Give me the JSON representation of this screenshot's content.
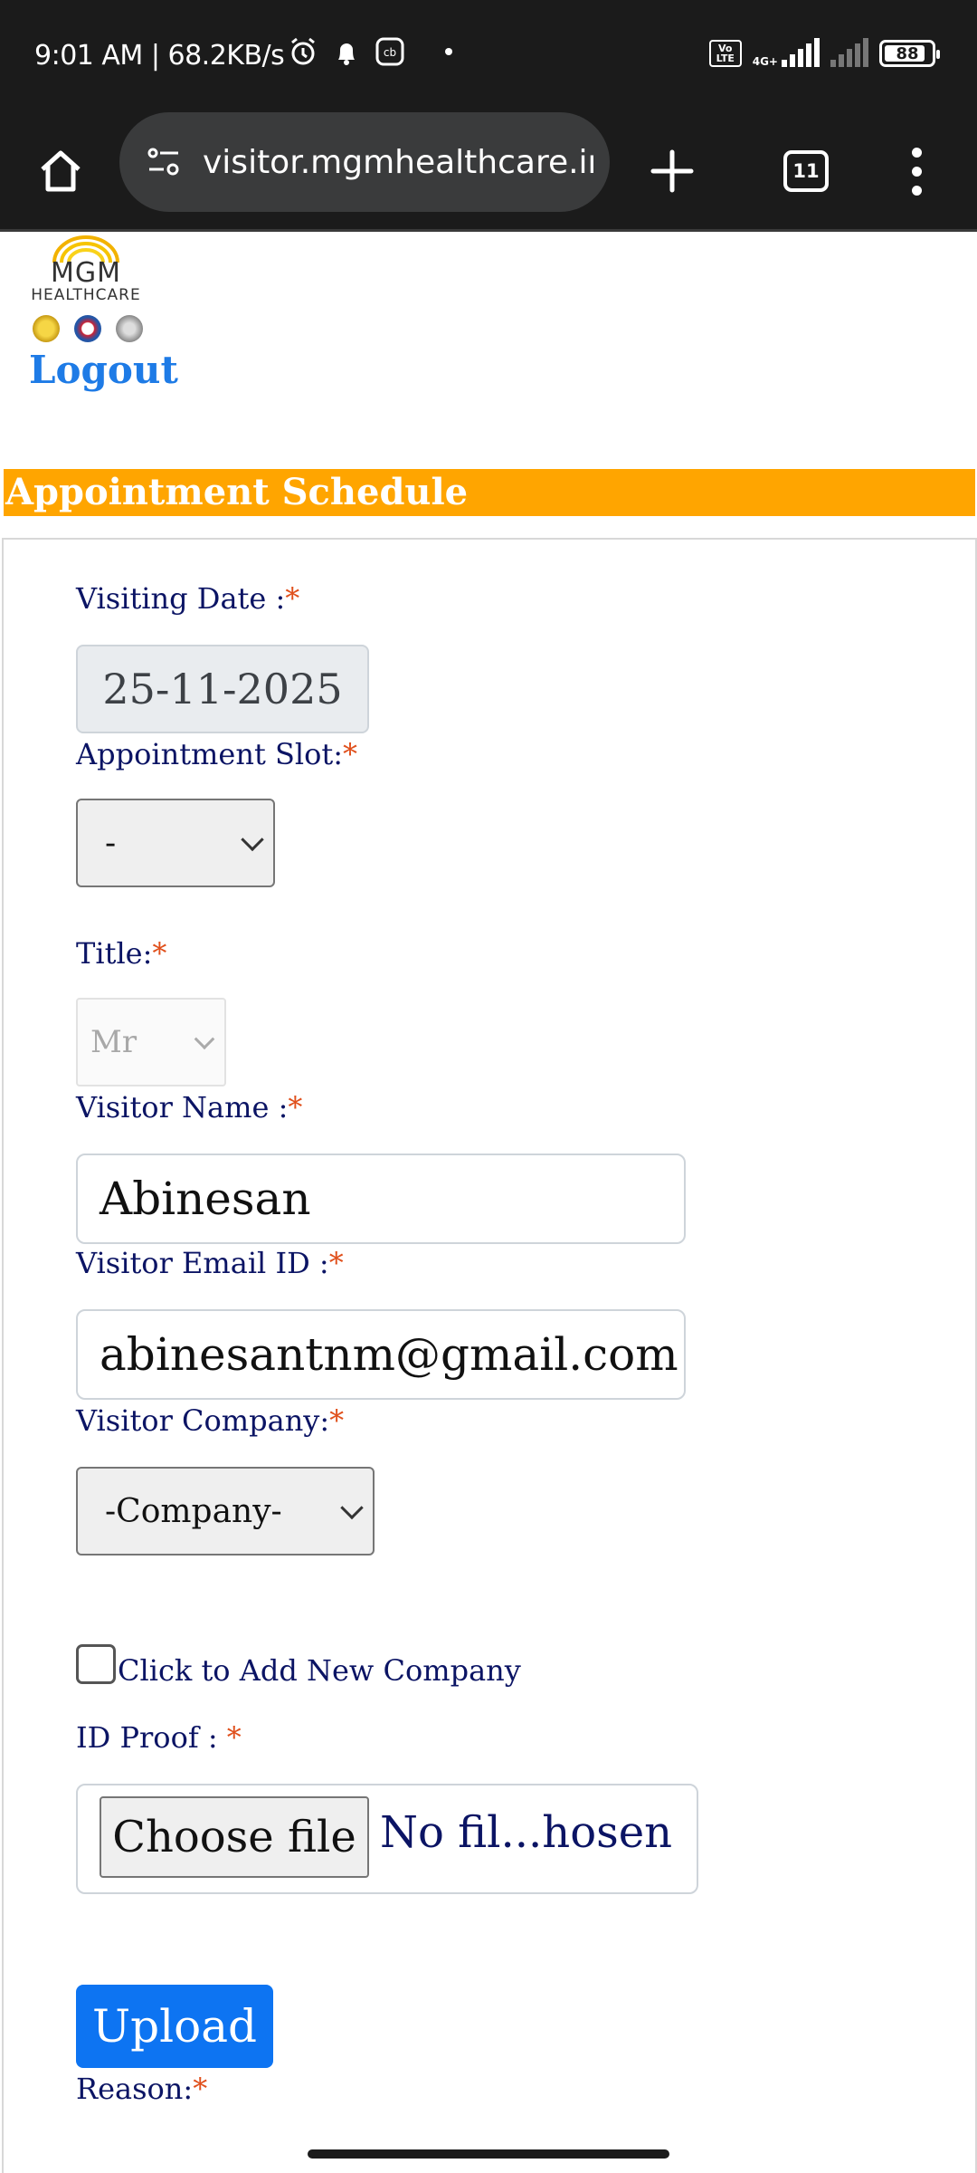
{
  "status_bar": {
    "time_speed": "9:01 AM | 68.2KB/s",
    "icons": [
      "alarm-icon",
      "notification-icon",
      "cb-icon"
    ],
    "volte": "Vo LTE",
    "network": "4G+",
    "battery": "88",
    "battery_fraction": 0.88
  },
  "browser": {
    "url": "visitor.mgmhealthcare.in/",
    "tab_count": "11"
  },
  "logo": {
    "name": "MGM",
    "sub": "HEALTHCARE"
  },
  "header": {
    "logout": "Logout",
    "section_title": "Appointment Schedule"
  },
  "form": {
    "visiting_date": {
      "label": "Visiting Date :",
      "value": "25-11-2025"
    },
    "appointment_slot": {
      "label": "Appointment Slot:",
      "value": "-"
    },
    "title": {
      "label": "Title:",
      "value": "Mr"
    },
    "visitor_name": {
      "label": "Visitor Name :",
      "value": "Abinesan"
    },
    "visitor_email": {
      "label": "Visitor Email ID :",
      "value": "abinesantnm@gmail.com"
    },
    "visitor_company": {
      "label": "Visitor Company:",
      "value": "-Company-"
    },
    "add_company": {
      "label": "Click to Add New Company"
    },
    "id_proof": {
      "label": "ID Proof : ",
      "button": "Choose file",
      "status": "No fil...hosen"
    },
    "upload": "Upload",
    "reason": {
      "label": "Reason:"
    },
    "required_mark": "*"
  }
}
